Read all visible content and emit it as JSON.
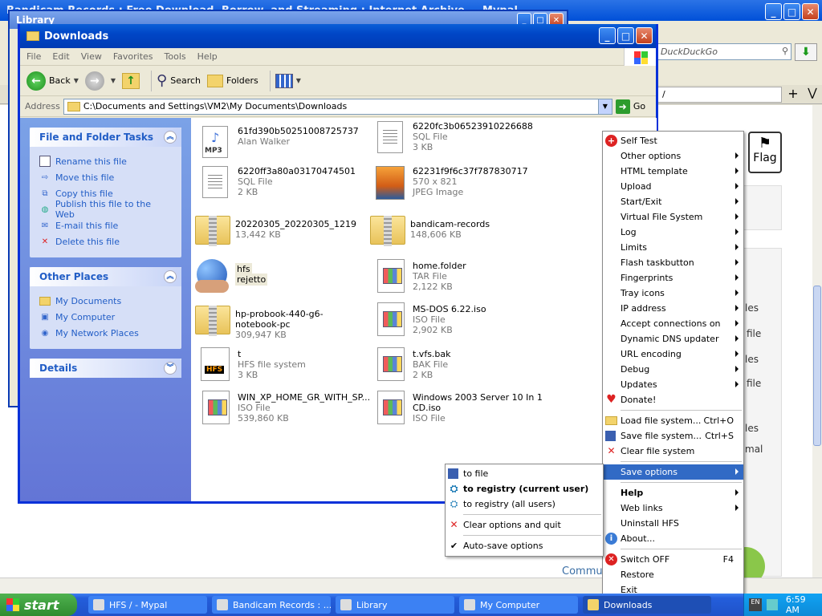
{
  "browser": {
    "title": "Bandicam Records : Free Download, Borrow, and Streaming : Internet Archive — Mypal",
    "search_placeholder": "DuckDuckGo",
    "tab_fragment": "/",
    "flag_label": "Flag",
    "fragments": [
      "les",
      "file",
      "les",
      "file",
      "les",
      "mal",
      "Commu"
    ]
  },
  "library": {
    "title": "Library"
  },
  "explorer": {
    "title": "Downloads",
    "menu": [
      "File",
      "Edit",
      "View",
      "Favorites",
      "Tools",
      "Help"
    ],
    "toolbar": {
      "back": "Back",
      "search": "Search",
      "folders": "Folders"
    },
    "address_label": "Address",
    "address_path": "C:\\Documents and Settings\\VM2\\My Documents\\Downloads",
    "go_label": "Go",
    "task_panels": [
      {
        "title": "File and Folder Tasks",
        "items": [
          "Rename this file",
          "Move this file",
          "Copy this file",
          "Publish this file to the Web",
          "E-mail this file",
          "Delete this file"
        ]
      },
      {
        "title": "Other Places",
        "items": [
          "My Documents",
          "My Computer",
          "My Network Places"
        ]
      },
      {
        "title": "Details",
        "items": []
      }
    ],
    "files": [
      {
        "name": "61fd390b50251008725737",
        "line2": "Alan Walker",
        "line3": "",
        "icon": "mp3-icon"
      },
      {
        "name": "6220fc3b06523910226688",
        "line2": "SQL File",
        "line3": "3 KB",
        "icon": "doc-icon"
      },
      {
        "name": "6220ff3a80a03170474501",
        "line2": "SQL File",
        "line3": "2 KB",
        "icon": "doc-icon"
      },
      {
        "name": "62231f9f6c37f787830717",
        "line2": "570 x 821",
        "line3": "JPEG Image",
        "icon": "image-icon"
      },
      {
        "name": "20220305_20220305_1219",
        "line2": "13,442 KB",
        "line3": "",
        "icon": "zip-folder-icon"
      },
      {
        "name": "bandicam-records",
        "line2": "148,606 KB",
        "line3": "",
        "icon": "zip-folder-icon"
      },
      {
        "name": "hfs",
        "line2": "rejetto",
        "line3": "",
        "icon": "globe-icon"
      },
      {
        "name": "home.folder",
        "line2": "TAR File",
        "line3": "2,122 KB",
        "icon": "window-icon"
      },
      {
        "name": "hp-probook-440-g6-notebook-pc",
        "line2": "309,947 KB",
        "line3": "",
        "icon": "zip-folder-icon"
      },
      {
        "name": "MS-DOS 6.22.iso",
        "line2": "ISO File",
        "line3": "2,902 KB",
        "icon": "window-icon"
      },
      {
        "name": "t",
        "line2": "HFS file system",
        "line3": "3 KB",
        "icon": "hfs-icon"
      },
      {
        "name": "t.vfs.bak",
        "line2": "BAK File",
        "line3": "2 KB",
        "icon": "window-icon"
      },
      {
        "name": "WIN_XP_HOME_GR_WITH_SP...",
        "line2": "ISO File",
        "line3": "539,860 KB",
        "icon": "window-icon"
      },
      {
        "name": "Windows 2003 Server 10 In 1",
        "line2": "CD.iso",
        "line3": "ISO File",
        "icon": "window-icon"
      }
    ]
  },
  "hfs_menu": {
    "items": [
      {
        "label": "Self Test",
        "icon": "red-cross-icon",
        "submenu": false
      },
      {
        "label": "Other options",
        "submenu": true
      },
      {
        "label": "HTML template",
        "submenu": true
      },
      {
        "label": "Upload",
        "submenu": true
      },
      {
        "label": "Start/Exit",
        "submenu": true
      },
      {
        "label": "Virtual File System",
        "submenu": true
      },
      {
        "label": "Log",
        "submenu": true
      },
      {
        "label": "Limits",
        "submenu": true
      },
      {
        "label": "Flash taskbutton",
        "submenu": true
      },
      {
        "label": "Fingerprints",
        "submenu": true
      },
      {
        "label": "Tray icons",
        "submenu": true
      },
      {
        "label": "IP address",
        "submenu": true
      },
      {
        "label": "Accept connections on",
        "submenu": true
      },
      {
        "label": "Dynamic DNS updater",
        "submenu": true
      },
      {
        "label": "URL encoding",
        "submenu": true
      },
      {
        "label": "Debug",
        "submenu": true
      },
      {
        "label": "Updates",
        "submenu": true
      },
      {
        "label": "Donate!",
        "icon": "heart-icon",
        "submenu": false
      },
      {
        "sep": true
      },
      {
        "label": "Load file system...",
        "shortcut": "Ctrl+O",
        "icon": "open-folder-icon"
      },
      {
        "label": "Save file system...",
        "shortcut": "Ctrl+S",
        "icon": "floppy-icon"
      },
      {
        "label": "Clear file system",
        "icon": "red-x-icon"
      },
      {
        "sep": true
      },
      {
        "label": "Save options",
        "submenu": true,
        "highlight": true
      },
      {
        "sep": true
      },
      {
        "label": "Help",
        "submenu": true,
        "bold": true
      },
      {
        "label": "Web links",
        "submenu": true
      },
      {
        "label": "Uninstall HFS"
      },
      {
        "label": "About...",
        "icon": "info-icon"
      },
      {
        "sep": true
      },
      {
        "label": "Switch OFF",
        "shortcut": "F4",
        "icon": "power-icon"
      },
      {
        "label": "Restore"
      },
      {
        "label": "Exit"
      }
    ]
  },
  "save_menu": {
    "items": [
      {
        "label": "to file",
        "icon": "floppy-icon"
      },
      {
        "label": "to registry (current user)",
        "icon": "registry-icon",
        "bold": true
      },
      {
        "label": "to registry (all users)",
        "icon": "registry-icon"
      },
      {
        "sep": true
      },
      {
        "label": "Clear options and quit",
        "icon": "red-x-icon"
      },
      {
        "sep": true
      },
      {
        "label": "Auto-save options",
        "icon": "check-icon"
      }
    ]
  },
  "taskbar": {
    "start": "start",
    "tasks": [
      {
        "label": "HFS / - Mypal",
        "active": false
      },
      {
        "label": "Bandicam Records : ...",
        "active": false
      },
      {
        "label": "Library",
        "active": false
      },
      {
        "label": "My Computer",
        "active": false
      },
      {
        "label": "Downloads",
        "active": true
      }
    ],
    "tray_badge": "EN",
    "clock": "6:59 AM"
  },
  "colors": {
    "xp_blue": "#0831d9",
    "menu_highlight": "#316ac5",
    "start_green": "#2f8c2f"
  }
}
